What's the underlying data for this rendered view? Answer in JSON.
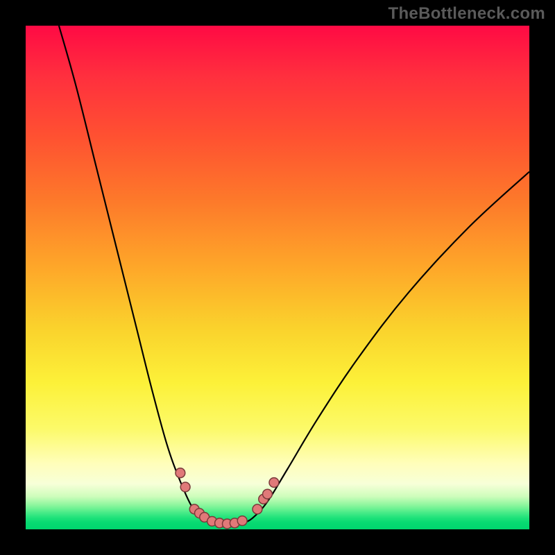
{
  "watermark": "TheBottleneck.com",
  "chart_data": {
    "type": "line",
    "title": "",
    "xlabel": "",
    "ylabel": "",
    "xlim": [
      0,
      100
    ],
    "ylim": [
      0,
      100
    ],
    "curve": [
      {
        "x": 6.6,
        "y": 100
      },
      {
        "x": 10,
        "y": 88
      },
      {
        "x": 14,
        "y": 72
      },
      {
        "x": 18,
        "y": 56
      },
      {
        "x": 22,
        "y": 40
      },
      {
        "x": 25,
        "y": 28
      },
      {
        "x": 28,
        "y": 17
      },
      {
        "x": 30.5,
        "y": 10
      },
      {
        "x": 33,
        "y": 4.5
      },
      {
        "x": 35,
        "y": 2.3
      },
      {
        "x": 37,
        "y": 1.3
      },
      {
        "x": 39,
        "y": 1.0
      },
      {
        "x": 41,
        "y": 1.0
      },
      {
        "x": 43,
        "y": 1.3
      },
      {
        "x": 45,
        "y": 2.2
      },
      {
        "x": 48,
        "y": 5.5
      },
      {
        "x": 52,
        "y": 12
      },
      {
        "x": 58,
        "y": 22
      },
      {
        "x": 66,
        "y": 34
      },
      {
        "x": 76,
        "y": 47
      },
      {
        "x": 88,
        "y": 60
      },
      {
        "x": 100,
        "y": 71
      }
    ],
    "markers": [
      {
        "x": 30.7,
        "y": 11.2
      },
      {
        "x": 31.7,
        "y": 8.4
      },
      {
        "x": 33.5,
        "y": 4.0
      },
      {
        "x": 34.5,
        "y": 3.2
      },
      {
        "x": 35.5,
        "y": 2.4
      },
      {
        "x": 37.0,
        "y": 1.6
      },
      {
        "x": 38.5,
        "y": 1.25
      },
      {
        "x": 40.0,
        "y": 1.1
      },
      {
        "x": 41.5,
        "y": 1.25
      },
      {
        "x": 43.0,
        "y": 1.7
      },
      {
        "x": 46.0,
        "y": 4.0
      },
      {
        "x": 47.2,
        "y": 6.0
      },
      {
        "x": 48.0,
        "y": 7.0
      },
      {
        "x": 49.3,
        "y": 9.3
      }
    ],
    "marker_radius_pct": 0.95,
    "colors": {
      "curve": "#000000",
      "marker_fill": "#e07979",
      "marker_stroke": "#7a3a3a",
      "gradient_top": "#ff0a44",
      "gradient_bottom": "#00d56e"
    }
  }
}
